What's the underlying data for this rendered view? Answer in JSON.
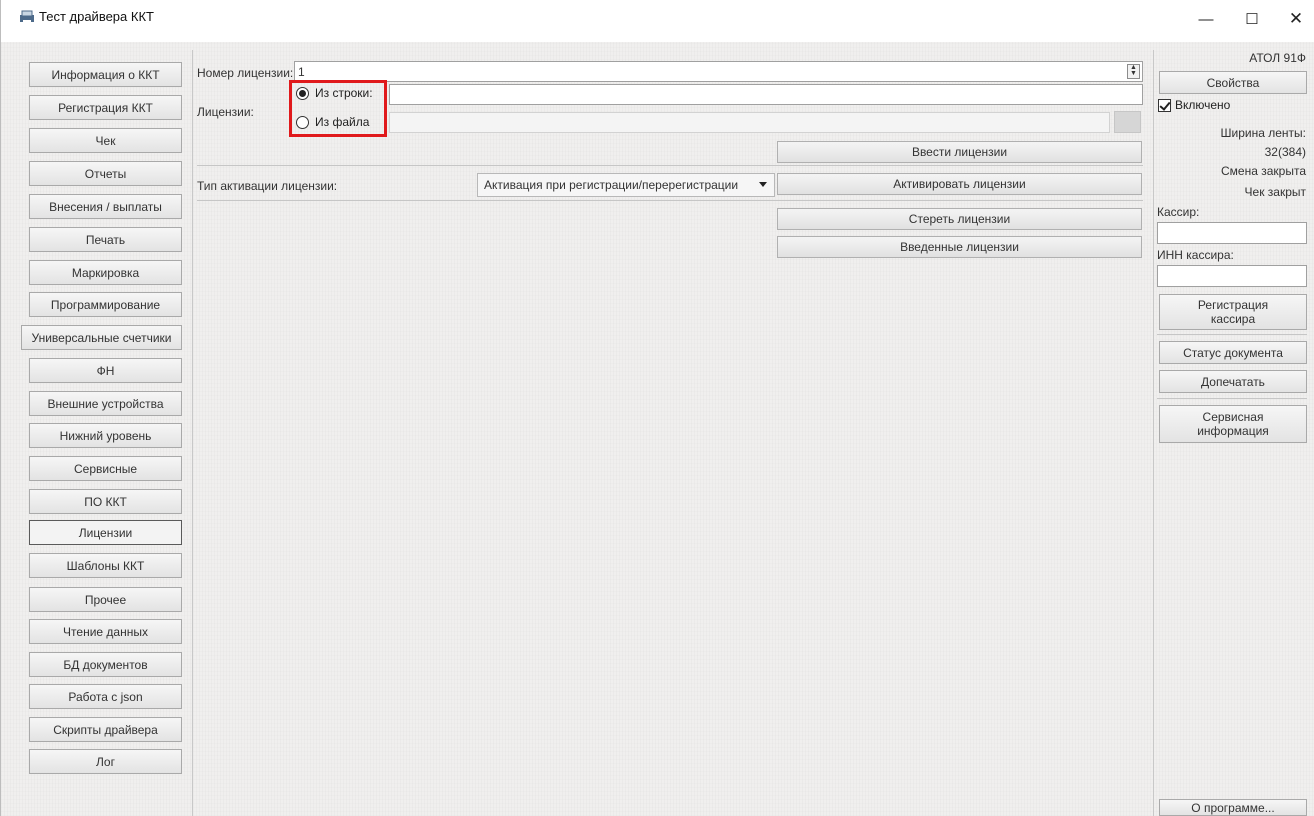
{
  "window": {
    "title": "Тест драйвера ККТ",
    "minimize_glyph": "—",
    "maximize_glyph": "☐",
    "close_glyph": "✕"
  },
  "nav": {
    "items": [
      {
        "label": "Информация о ККТ"
      },
      {
        "label": "Регистрация ККТ"
      },
      {
        "label": "Чек"
      },
      {
        "label": "Отчеты"
      },
      {
        "label": "Внесения / выплаты"
      },
      {
        "label": "Печать"
      },
      {
        "label": "Маркировка"
      },
      {
        "label": "Программирование"
      },
      {
        "label": "Универсальные счетчики"
      },
      {
        "label": "ФН"
      },
      {
        "label": "Внешние устройства"
      },
      {
        "label": "Нижний уровень"
      },
      {
        "label": "Сервисные"
      },
      {
        "label": "ПО ККТ"
      },
      {
        "label": "Лицензии"
      },
      {
        "label": "Шаблоны ККТ"
      },
      {
        "label": "Прочее"
      },
      {
        "label": "Чтение данных"
      },
      {
        "label": "БД документов"
      },
      {
        "label": "Работа с json"
      },
      {
        "label": "Скрипты драйвера"
      },
      {
        "label": "Лог"
      }
    ],
    "active_index": 14
  },
  "licenses": {
    "number_label": "Номер лицензии:",
    "number_value": "1",
    "licenses_label": "Лицензии:",
    "from_string_label": "Из строки:",
    "from_file_label": "Из файла",
    "selected_source": "from_string",
    "from_string_value": "",
    "file_path_value": "",
    "enter_button": "Ввести лицензии",
    "activation_type_label": "Тип активации лицензии:",
    "activation_type_value": "Активация при регистрации/перерегистрации",
    "activate_button": "Активировать лицензии",
    "erase_button": "Стереть лицензии",
    "entered_button": "Введенные лицензии"
  },
  "right_panel": {
    "device_model": "АТОЛ 91Ф",
    "properties_button": "Свойства",
    "enabled_label": "Включено",
    "enabled_checked": true,
    "tape_width_label": "Ширина ленты:",
    "tape_width_value": "32(384)",
    "shift_status": "Смена закрыта",
    "receipt_status": "Чек закрыт",
    "cashier_label": "Кассир:",
    "cashier_value": "",
    "cashier_inn_label": "ИНН кассира:",
    "cashier_inn_value": "",
    "register_cashier_button": "Регистрация кассира",
    "document_status_button": "Статус документа",
    "reprint_button": "Допечатать",
    "service_info_button": "Сервисная информация",
    "about_button": "О программе..."
  },
  "colors": {
    "highlight": "#e0191b"
  }
}
